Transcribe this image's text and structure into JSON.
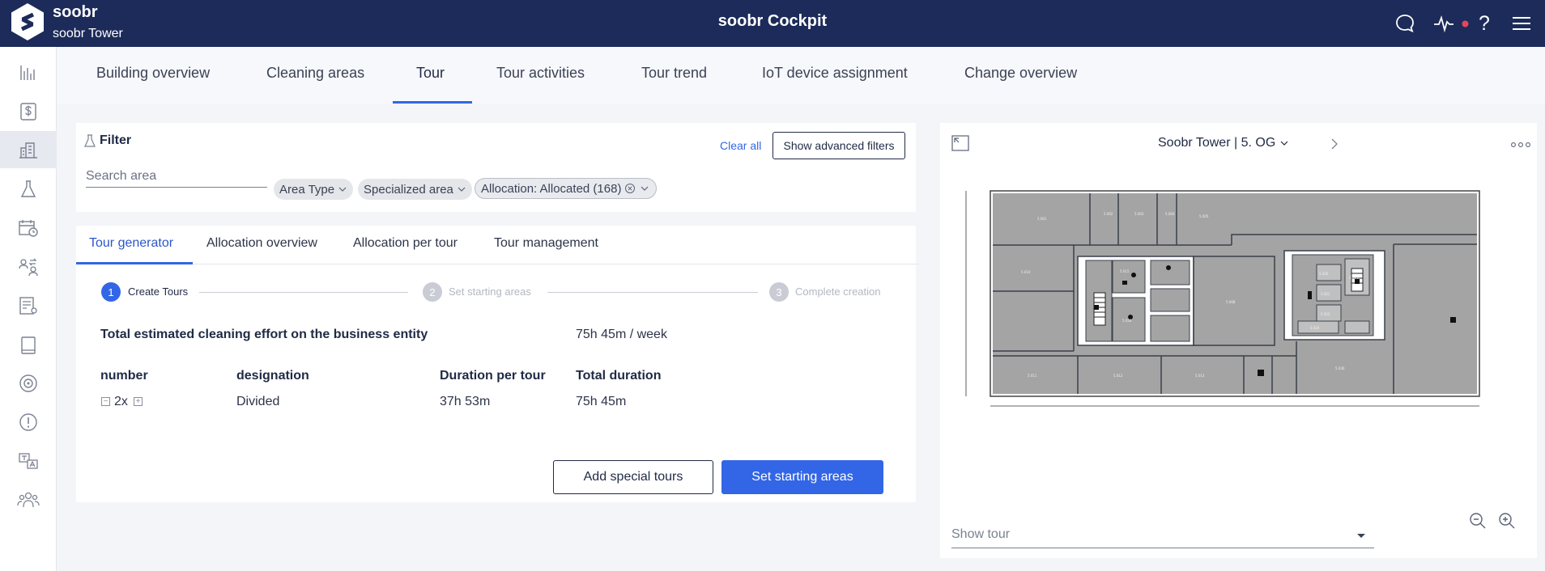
{
  "header": {
    "brand": "soobr",
    "building": "soobr Tower",
    "app_title": "soobr Cockpit"
  },
  "sidebar_icons": [
    "bar-chart-icon",
    "dollar-icon",
    "building-icon",
    "flask-icon",
    "calendar-clock-icon",
    "swap-icon",
    "document-icon",
    "tablet-icon",
    "target-icon",
    "alert-icon",
    "translate-icon",
    "team-icon"
  ],
  "main_tabs": [
    "Building overview",
    "Cleaning areas",
    "Tour",
    "Tour activities",
    "Tour trend",
    "IoT device assignment",
    "Change overview"
  ],
  "main_active_tab": "Tour",
  "filter": {
    "title": "Filter",
    "clear_all": "Clear all",
    "advanced": "Show advanced filters",
    "search_placeholder": "Search area",
    "chips": [
      "Area Type",
      "Specialized area",
      "Allocation: Allocated (168)"
    ]
  },
  "sub_tabs": [
    "Tour generator",
    "Allocation overview",
    "Allocation per tour",
    "Tour management"
  ],
  "steps": [
    {
      "number": "1",
      "label": "Create Tours",
      "active": true
    },
    {
      "number": "2",
      "label": "Set starting areas",
      "active": false
    },
    {
      "number": "3",
      "label": "Complete creation",
      "active": false
    }
  ],
  "effort": {
    "label": "Total estimated cleaning effort on the business entity",
    "value": "75h 45m / week"
  },
  "table": {
    "headers": [
      "number",
      "designation",
      "Duration per tour",
      "Total duration"
    ],
    "row": {
      "number": "2x",
      "designation": "Divided",
      "duration_per_tour": "37h 53m",
      "total_duration": "75h 45m"
    }
  },
  "buttons": {
    "add_special": "Add special tours",
    "set_starting": "Set starting areas"
  },
  "map": {
    "floor": "Soobr Tower | 5. OG",
    "show_tour_placeholder": "Show tour"
  },
  "colors": {
    "header_bg": "#1c2b59",
    "accent": "#3366e6",
    "notification_dot": "#e8455a"
  }
}
